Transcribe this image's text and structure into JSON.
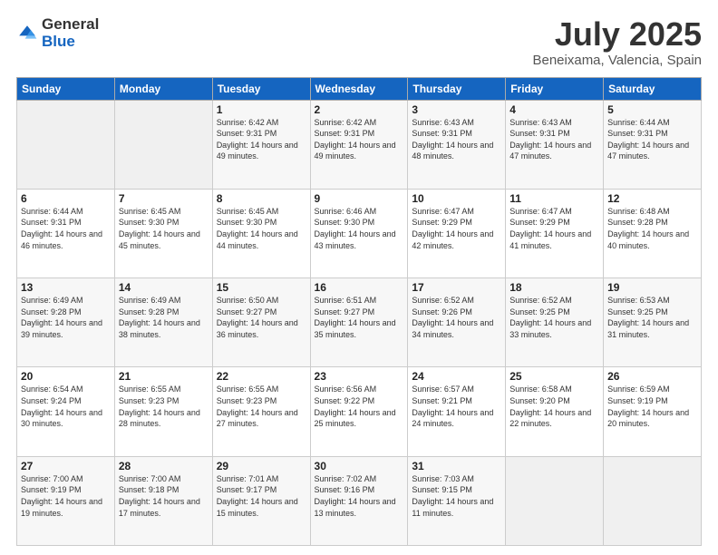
{
  "logo": {
    "general": "General",
    "blue": "Blue"
  },
  "title": {
    "month_year": "July 2025",
    "location": "Beneixama, Valencia, Spain"
  },
  "weekdays": [
    "Sunday",
    "Monday",
    "Tuesday",
    "Wednesday",
    "Thursday",
    "Friday",
    "Saturday"
  ],
  "weeks": [
    [
      {
        "day": "",
        "sunrise": "",
        "sunset": "",
        "daylight": ""
      },
      {
        "day": "",
        "sunrise": "",
        "sunset": "",
        "daylight": ""
      },
      {
        "day": "1",
        "sunrise": "Sunrise: 6:42 AM",
        "sunset": "Sunset: 9:31 PM",
        "daylight": "Daylight: 14 hours and 49 minutes."
      },
      {
        "day": "2",
        "sunrise": "Sunrise: 6:42 AM",
        "sunset": "Sunset: 9:31 PM",
        "daylight": "Daylight: 14 hours and 49 minutes."
      },
      {
        "day": "3",
        "sunrise": "Sunrise: 6:43 AM",
        "sunset": "Sunset: 9:31 PM",
        "daylight": "Daylight: 14 hours and 48 minutes."
      },
      {
        "day": "4",
        "sunrise": "Sunrise: 6:43 AM",
        "sunset": "Sunset: 9:31 PM",
        "daylight": "Daylight: 14 hours and 47 minutes."
      },
      {
        "day": "5",
        "sunrise": "Sunrise: 6:44 AM",
        "sunset": "Sunset: 9:31 PM",
        "daylight": "Daylight: 14 hours and 47 minutes."
      }
    ],
    [
      {
        "day": "6",
        "sunrise": "Sunrise: 6:44 AM",
        "sunset": "Sunset: 9:31 PM",
        "daylight": "Daylight: 14 hours and 46 minutes."
      },
      {
        "day": "7",
        "sunrise": "Sunrise: 6:45 AM",
        "sunset": "Sunset: 9:30 PM",
        "daylight": "Daylight: 14 hours and 45 minutes."
      },
      {
        "day": "8",
        "sunrise": "Sunrise: 6:45 AM",
        "sunset": "Sunset: 9:30 PM",
        "daylight": "Daylight: 14 hours and 44 minutes."
      },
      {
        "day": "9",
        "sunrise": "Sunrise: 6:46 AM",
        "sunset": "Sunset: 9:30 PM",
        "daylight": "Daylight: 14 hours and 43 minutes."
      },
      {
        "day": "10",
        "sunrise": "Sunrise: 6:47 AM",
        "sunset": "Sunset: 9:29 PM",
        "daylight": "Daylight: 14 hours and 42 minutes."
      },
      {
        "day": "11",
        "sunrise": "Sunrise: 6:47 AM",
        "sunset": "Sunset: 9:29 PM",
        "daylight": "Daylight: 14 hours and 41 minutes."
      },
      {
        "day": "12",
        "sunrise": "Sunrise: 6:48 AM",
        "sunset": "Sunset: 9:28 PM",
        "daylight": "Daylight: 14 hours and 40 minutes."
      }
    ],
    [
      {
        "day": "13",
        "sunrise": "Sunrise: 6:49 AM",
        "sunset": "Sunset: 9:28 PM",
        "daylight": "Daylight: 14 hours and 39 minutes."
      },
      {
        "day": "14",
        "sunrise": "Sunrise: 6:49 AM",
        "sunset": "Sunset: 9:28 PM",
        "daylight": "Daylight: 14 hours and 38 minutes."
      },
      {
        "day": "15",
        "sunrise": "Sunrise: 6:50 AM",
        "sunset": "Sunset: 9:27 PM",
        "daylight": "Daylight: 14 hours and 36 minutes."
      },
      {
        "day": "16",
        "sunrise": "Sunrise: 6:51 AM",
        "sunset": "Sunset: 9:27 PM",
        "daylight": "Daylight: 14 hours and 35 minutes."
      },
      {
        "day": "17",
        "sunrise": "Sunrise: 6:52 AM",
        "sunset": "Sunset: 9:26 PM",
        "daylight": "Daylight: 14 hours and 34 minutes."
      },
      {
        "day": "18",
        "sunrise": "Sunrise: 6:52 AM",
        "sunset": "Sunset: 9:25 PM",
        "daylight": "Daylight: 14 hours and 33 minutes."
      },
      {
        "day": "19",
        "sunrise": "Sunrise: 6:53 AM",
        "sunset": "Sunset: 9:25 PM",
        "daylight": "Daylight: 14 hours and 31 minutes."
      }
    ],
    [
      {
        "day": "20",
        "sunrise": "Sunrise: 6:54 AM",
        "sunset": "Sunset: 9:24 PM",
        "daylight": "Daylight: 14 hours and 30 minutes."
      },
      {
        "day": "21",
        "sunrise": "Sunrise: 6:55 AM",
        "sunset": "Sunset: 9:23 PM",
        "daylight": "Daylight: 14 hours and 28 minutes."
      },
      {
        "day": "22",
        "sunrise": "Sunrise: 6:55 AM",
        "sunset": "Sunset: 9:23 PM",
        "daylight": "Daylight: 14 hours and 27 minutes."
      },
      {
        "day": "23",
        "sunrise": "Sunrise: 6:56 AM",
        "sunset": "Sunset: 9:22 PM",
        "daylight": "Daylight: 14 hours and 25 minutes."
      },
      {
        "day": "24",
        "sunrise": "Sunrise: 6:57 AM",
        "sunset": "Sunset: 9:21 PM",
        "daylight": "Daylight: 14 hours and 24 minutes."
      },
      {
        "day": "25",
        "sunrise": "Sunrise: 6:58 AM",
        "sunset": "Sunset: 9:20 PM",
        "daylight": "Daylight: 14 hours and 22 minutes."
      },
      {
        "day": "26",
        "sunrise": "Sunrise: 6:59 AM",
        "sunset": "Sunset: 9:19 PM",
        "daylight": "Daylight: 14 hours and 20 minutes."
      }
    ],
    [
      {
        "day": "27",
        "sunrise": "Sunrise: 7:00 AM",
        "sunset": "Sunset: 9:19 PM",
        "daylight": "Daylight: 14 hours and 19 minutes."
      },
      {
        "day": "28",
        "sunrise": "Sunrise: 7:00 AM",
        "sunset": "Sunset: 9:18 PM",
        "daylight": "Daylight: 14 hours and 17 minutes."
      },
      {
        "day": "29",
        "sunrise": "Sunrise: 7:01 AM",
        "sunset": "Sunset: 9:17 PM",
        "daylight": "Daylight: 14 hours and 15 minutes."
      },
      {
        "day": "30",
        "sunrise": "Sunrise: 7:02 AM",
        "sunset": "Sunset: 9:16 PM",
        "daylight": "Daylight: 14 hours and 13 minutes."
      },
      {
        "day": "31",
        "sunrise": "Sunrise: 7:03 AM",
        "sunset": "Sunset: 9:15 PM",
        "daylight": "Daylight: 14 hours and 11 minutes."
      },
      {
        "day": "",
        "sunrise": "",
        "sunset": "",
        "daylight": ""
      },
      {
        "day": "",
        "sunrise": "",
        "sunset": "",
        "daylight": ""
      }
    ]
  ]
}
